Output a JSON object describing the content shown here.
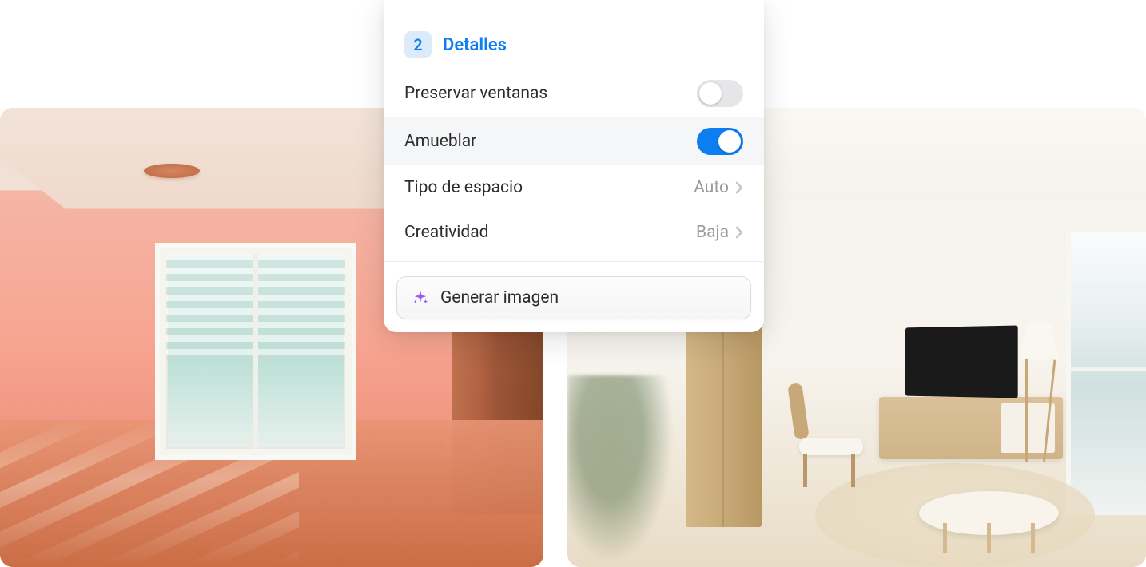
{
  "panel": {
    "step_number": "2",
    "step_title": "Detalles",
    "rows": {
      "preserve_windows": {
        "label": "Preservar ventanas",
        "toggled": false
      },
      "furnish": {
        "label": "Amueblar",
        "toggled": true
      },
      "space_type": {
        "label": "Tipo de espacio",
        "value": "Auto"
      },
      "creativity": {
        "label": "Creatividad",
        "value": "Baja"
      }
    },
    "generate_button_label": "Generar imagen"
  }
}
